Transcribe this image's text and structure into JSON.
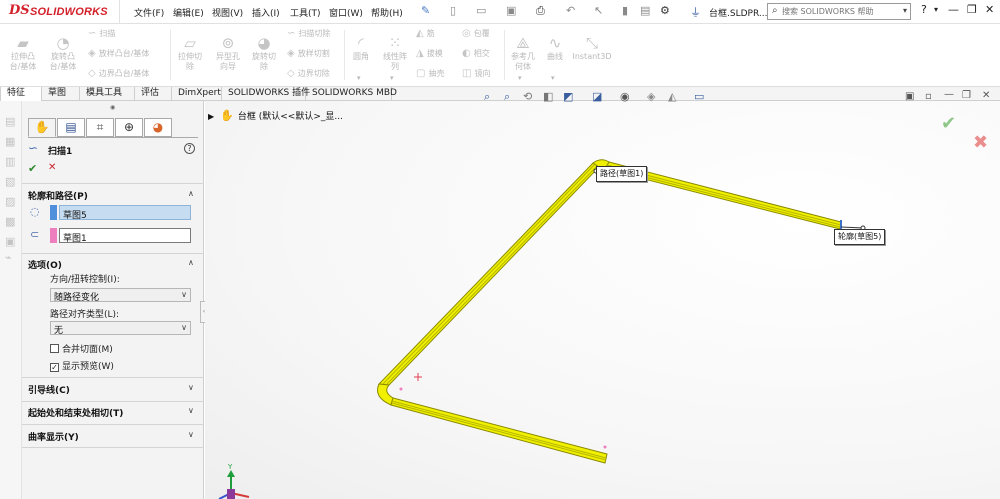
{
  "app": {
    "logo_mark": "DS",
    "logo_text": "SOLIDWORKS",
    "doc_title": "台框.SLDPR...",
    "search_placeholder": "搜索 SOLIDWORKS 帮助",
    "menu": [
      "文件(F)",
      "编辑(E)",
      "视图(V)",
      "插入(I)",
      "工具(T)",
      "窗口(W)",
      "帮助(H)"
    ]
  },
  "ribbon": {
    "large": [
      {
        "label1": "拉伸凸",
        "label2": "台/基体",
        "icon": "extrude-boss-icon"
      },
      {
        "label1": "旋转凸",
        "label2": "台/基体",
        "icon": "revolve-boss-icon"
      },
      {
        "label1": "拉伸切",
        "label2": "除",
        "icon": "extrude-cut-icon"
      },
      {
        "label1": "异型孔",
        "label2": "向导",
        "icon": "hole-wizard-icon"
      },
      {
        "label1": "旋转切",
        "label2": "除",
        "icon": "revolve-cut-icon"
      },
      {
        "label1": "圆角",
        "label2": "",
        "icon": "fillet-icon"
      },
      {
        "label1": "线性阵",
        "label2": "列",
        "icon": "linear-pattern-icon"
      },
      {
        "label1": "参考几",
        "label2": "何体",
        "icon": "reference-geometry-icon"
      },
      {
        "label1": "曲线",
        "label2": "",
        "icon": "curves-icon"
      },
      {
        "label1": "Instant3D",
        "label2": "",
        "icon": "instant3d-icon"
      }
    ],
    "small_col1": [
      "扫描",
      "放样凸台/基体",
      "边界凸台/基体"
    ],
    "small_col2": [
      "扫描切除",
      "放样切割",
      "边界切除"
    ],
    "small_col3": [
      "筋",
      "拔模",
      "抽壳"
    ],
    "small_col4": [
      "包覆",
      "相交",
      "镜向"
    ]
  },
  "tabs": [
    "特征",
    "草图",
    "模具工具",
    "评估",
    "DimXpert",
    "SOLIDWORKS 插件",
    "SOLIDWORKS MBD"
  ],
  "property_manager": {
    "title": "扫描1",
    "help": "?",
    "profile_section": "轮廓和路径(P)",
    "profile_value": "草图5",
    "path_value": "草图1",
    "options_section": "选项(O)",
    "orientation_label": "方向/扭转控制(I):",
    "orientation_value": "随路径变化",
    "alignment_label": "路径对齐类型(L):",
    "alignment_value": "无",
    "merge_tangent_label": "合并切面(M)",
    "merge_tangent_checked": false,
    "show_preview_label": "显示预览(W)",
    "show_preview_checked": true,
    "guide_curves_section": "引导线(C)",
    "start_end_section": "起始处和结束处相切(T)",
    "curvature_section": "曲率显示(Y)"
  },
  "graphics": {
    "tree_label": "台框  (默认<<默认>_显...",
    "path_callout": "路径(草图1)",
    "profile_callout": "轮廓(草图5)",
    "triad_y": "Y",
    "sweep_color": "#f0f000",
    "sweep_edge_color": "#8a8a00"
  },
  "colors": {
    "profile_swatch": "#4f8fdc",
    "path_swatch": "#ee7fbf",
    "accent_red": "#d4202a"
  }
}
